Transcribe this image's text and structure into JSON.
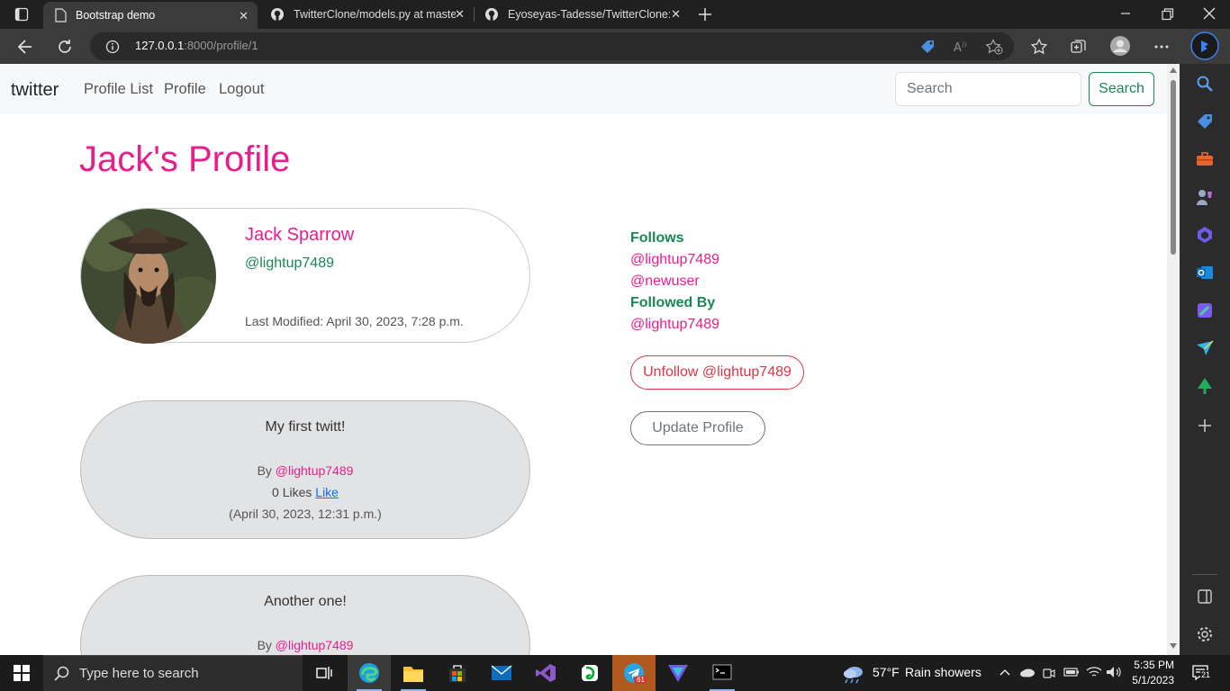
{
  "browser": {
    "tabs": [
      {
        "title": "Bootstrap demo",
        "icon": "document-icon",
        "active": true
      },
      {
        "title": "TwitterClone/models.py at maste",
        "icon": "github-icon",
        "active": false
      },
      {
        "title": "Eyoseyas-Tadesse/TwitterClone: S",
        "icon": "github-icon",
        "active": false
      }
    ],
    "url_host": "127.0.0.1",
    "url_path": ":8000/profile/1"
  },
  "navbar": {
    "brand": "twitter",
    "links": [
      "Profile List",
      "Profile",
      "Logout"
    ],
    "search_placeholder": "Search",
    "search_button": "Search"
  },
  "profile": {
    "heading": "Jack's Profile",
    "name": "Jack Sparrow",
    "handle": "@lightup7489",
    "last_modified": "Last Modified: April 30, 2023, 7:28 p.m."
  },
  "follows": {
    "follows_label": "Follows",
    "follows": [
      "@lightup7489",
      "@newuser"
    ],
    "followed_by_label": "Followed By",
    "followed_by": [
      "@lightup7489"
    ],
    "unfollow_button": "Unfollow @lightup7489",
    "update_button": "Update Profile"
  },
  "tweets": [
    {
      "body": "My first twitt!",
      "by_label": "By",
      "author": "@lightup7489",
      "likes": "0 Likes",
      "like_link": "Like",
      "date": "(April 30, 2023, 12:31 p.m.)"
    },
    {
      "body": "Another one!",
      "by_label": "By",
      "author": "@lightup7489"
    }
  ],
  "taskbar": {
    "search_placeholder": "Type here to search",
    "weather_temp": "57°F",
    "weather_text": "Rain showers",
    "time": "5:35 PM",
    "date": "5/1/2023",
    "telegram_badge": "61",
    "notification_count": "21"
  },
  "colors": {
    "accent_pink": "#e91e8c",
    "success_green": "#198754",
    "danger_red": "#dc3545",
    "tweet_bg": "#e2e3e5"
  }
}
